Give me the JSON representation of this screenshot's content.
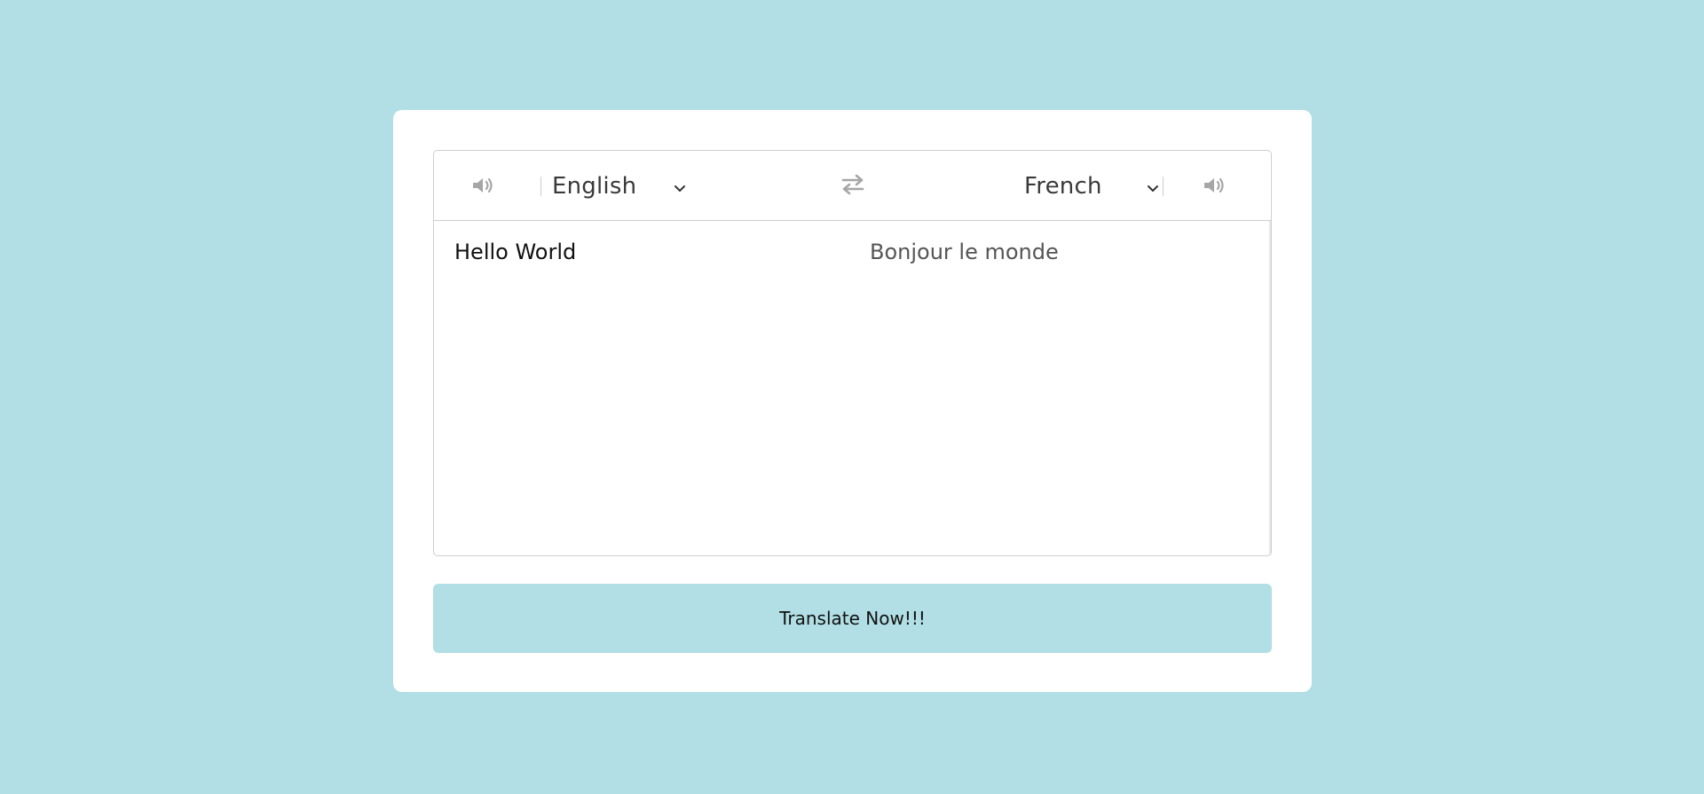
{
  "app": {
    "from_language": "English",
    "to_language": "French",
    "from_text": "Hello World",
    "to_text": "Bonjour le monde",
    "translate_button_label": "Translate Now!!!"
  },
  "icons": {
    "from_speaker": "volume-icon",
    "to_speaker": "volume-icon",
    "exchange": "exchange-icon",
    "from_dropdown": "chevron-down-icon",
    "to_dropdown": "chevron-down-icon"
  },
  "colors": {
    "background": "#b1dfe5",
    "card": "#ffffff",
    "button": "#b1dfe5",
    "icon": "#a6a6a6"
  }
}
